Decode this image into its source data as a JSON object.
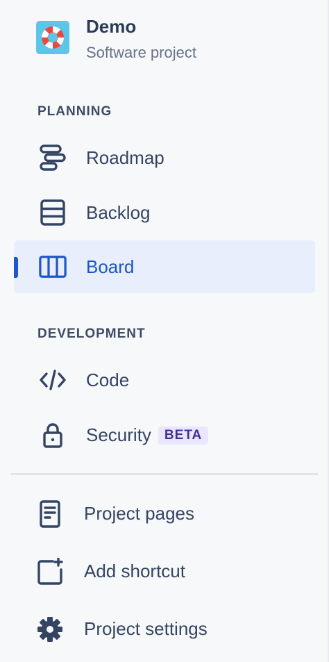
{
  "project": {
    "name": "Demo",
    "type": "Software project",
    "avatar_icon": "lifebuoy-icon"
  },
  "sections": {
    "planning": "PLANNING",
    "development": "DEVELOPMENT"
  },
  "nav": {
    "roadmap": {
      "label": "Roadmap",
      "icon": "roadmap-icon"
    },
    "backlog": {
      "label": "Backlog",
      "icon": "backlog-icon"
    },
    "board": {
      "label": "Board",
      "icon": "board-icon",
      "active": true
    },
    "code": {
      "label": "Code",
      "icon": "code-icon"
    },
    "security": {
      "label": "Security",
      "badge": "BETA",
      "icon": "lock-icon"
    }
  },
  "footer": {
    "project_pages": {
      "label": "Project pages",
      "icon": "page-icon"
    },
    "add_shortcut": {
      "label": "Add shortcut",
      "icon": "add-shortcut-icon"
    },
    "project_settings": {
      "label": "Project settings",
      "icon": "gear-icon"
    }
  },
  "colors": {
    "background": "#f7f8fa",
    "active_background": "#e8eefb",
    "active_text": "#1d55c4",
    "text": "#344563",
    "badge_background": "#eae6ff",
    "badge_text": "#403294"
  }
}
